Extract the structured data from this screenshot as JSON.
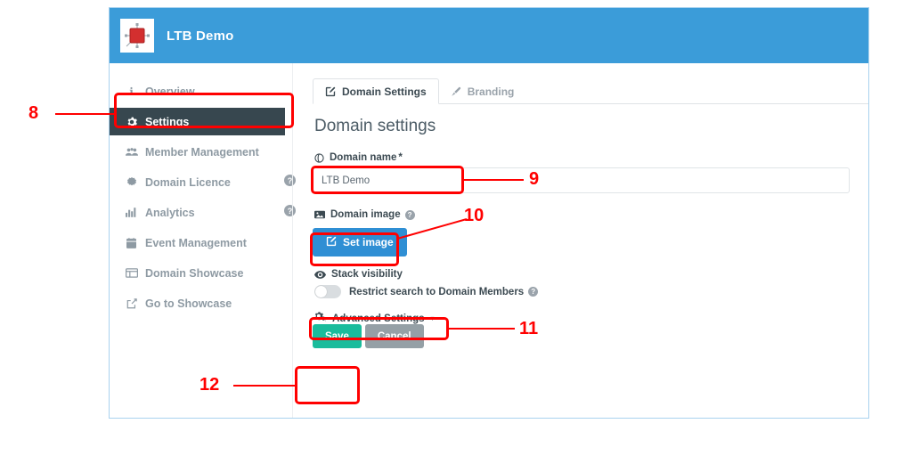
{
  "app": {
    "title": "LTB Demo",
    "logo_icon": "red-square-node-icon",
    "header_color": "#3b9cd9"
  },
  "sidebar": {
    "items": [
      {
        "label": "Overview",
        "icon": "info-icon",
        "active": false,
        "help": false
      },
      {
        "label": "Settings",
        "icon": "gear-icon",
        "active": true,
        "help": false
      },
      {
        "label": "Member Management",
        "icon": "users-icon",
        "active": false,
        "help": false
      },
      {
        "label": "Domain Licence",
        "icon": "certificate-icon",
        "active": false,
        "help": false
      },
      {
        "label": "Analytics",
        "icon": "bar-chart-icon",
        "active": false,
        "help": false
      },
      {
        "label": "Event Management",
        "icon": "calendar-icon",
        "active": false,
        "help": true
      },
      {
        "label": "Domain Showcase",
        "icon": "window-icon",
        "active": false,
        "help": true
      },
      {
        "label": "Go to Showcase",
        "icon": "external-link-icon",
        "active": false,
        "help": false
      }
    ],
    "help_glyph": "?"
  },
  "main": {
    "tabs": [
      {
        "label": "Domain Settings",
        "icon": "edit-square-icon",
        "active": true
      },
      {
        "label": "Branding",
        "icon": "paintbrush-icon",
        "active": false
      }
    ],
    "heading": "Domain settings",
    "domain_name": {
      "label": "Domain name",
      "required_mark": "*",
      "icon": "globe-circle-icon",
      "value": "LTB Demo",
      "placeholder": "Domain name"
    },
    "domain_image": {
      "label": "Domain image",
      "icon": "image-icon",
      "help_glyph": "?",
      "button_label": "Set image",
      "button_icon": "edit-square-icon",
      "button_color": "#2f8fd4"
    },
    "stack_visibility": {
      "label": "Stack visibility",
      "icon": "eye-icon",
      "toggle_label": "Restrict search to Domain Members",
      "toggle_on": false,
      "help_glyph": "?"
    },
    "advanced_settings": {
      "label": "Advanced Settings",
      "icon": "gears-icon",
      "caret": "▾"
    },
    "actions": {
      "save_label": "Save",
      "save_color": "#1abc9c",
      "cancel_label": "Cancel",
      "cancel_color": "#95a0a6"
    }
  },
  "annotations": {
    "color": "#ff0000",
    "callouts": [
      {
        "number": "8",
        "target": "sidebar-item-settings"
      },
      {
        "number": "9",
        "target": "domain-name-input"
      },
      {
        "number": "10",
        "target": "set-image-button"
      },
      {
        "number": "11",
        "target": "advanced-settings"
      },
      {
        "number": "12",
        "target": "save-button"
      }
    ]
  }
}
